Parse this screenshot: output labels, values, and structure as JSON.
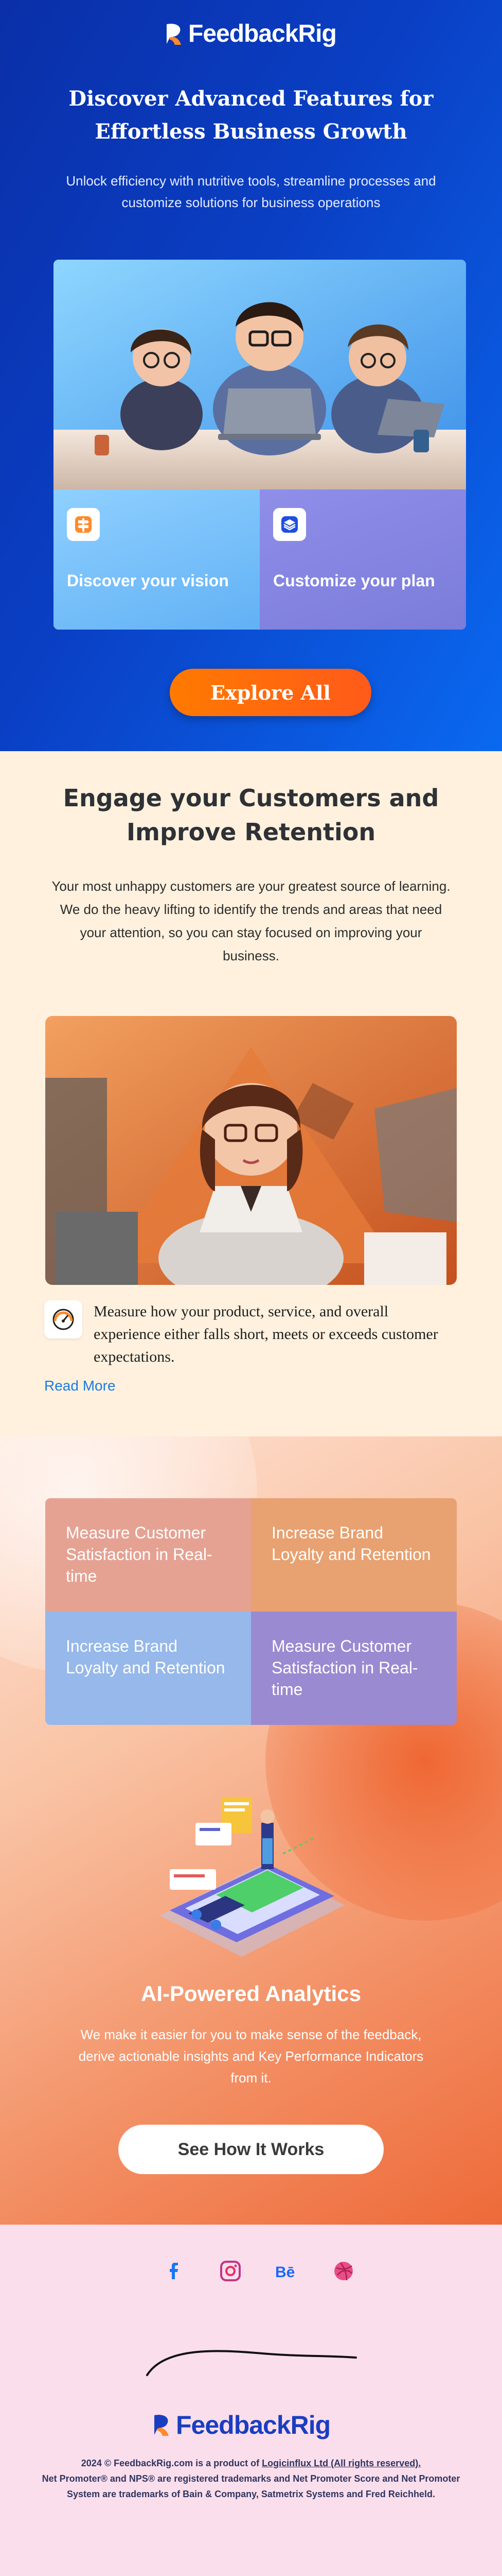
{
  "brand": {
    "name": "FeedbackRig"
  },
  "hero": {
    "title_line1": "Discover Advanced Features for",
    "title_line2": "Effortless Business Growth",
    "subtitle": "Unlock efficiency with nutritive tools, streamline processes and customize solutions for business operations",
    "features": [
      {
        "label": "Discover your vision",
        "icon": "signpost-icon"
      },
      {
        "label": "Customize your plan",
        "icon": "layers-icon"
      }
    ],
    "cta": "Explore All"
  },
  "engage": {
    "title": "Engage your Customers and Improve Retention",
    "text": "Your most unhappy customers are your greatest source of learning. We do the heavy lifting to identify the trends and areas that need your attention, so you can stay focused on improving your business.",
    "measure_text": "Measure how your product, service, and overall experience either falls short, meets or exceeds customer expectations.",
    "measure_icon": "gauge-icon",
    "read_more": "Read More"
  },
  "analytics": {
    "tiles": [
      "Measure Customer Satisfaction in Real-time",
      "Increase Brand Loyalty and Retention",
      "Increase Brand Loyalty and Retention",
      "Measure Customer Satisfaction in Real-time"
    ],
    "title": "AI-Powered Analytics",
    "text": "We make it easier for you to make sense of the feedback, derive actionable insights and Key Performance Indicators from it.",
    "cta": "See How It Works"
  },
  "footer": {
    "social": [
      {
        "name": "facebook-icon",
        "glyph": "f",
        "color": "#1877f2"
      },
      {
        "name": "instagram-icon",
        "glyph": "",
        "color": "#c13584"
      },
      {
        "name": "behance-icon",
        "glyph": "Bē",
        "color": "#1769ff"
      },
      {
        "name": "dribbble-icon",
        "glyph": "",
        "color": "#ea4c89"
      }
    ],
    "legal_prefix": "2024 © FeedbackRig.com is a product of ",
    "legal_link": "Logicinflux Ltd (All rights reserved).",
    "legal_rest": "Net Promoter® and NPS® are registered trademarks and Net Promoter Score and Net Promoter System are trademarks of Bain & Company, Satmetrix Systems and Fred Reichheld."
  },
  "colors": {
    "brand_blue": "#0a3fc4",
    "cta_orange": "#ff6a10",
    "link_blue": "#1a7be0"
  }
}
